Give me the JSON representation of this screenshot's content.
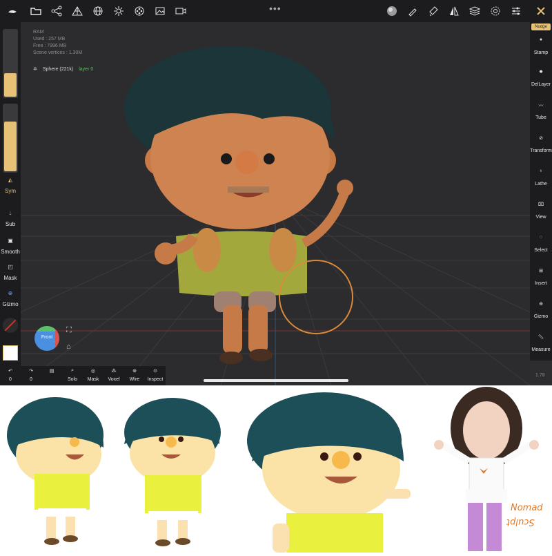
{
  "app": {
    "info": {
      "ram_label": "RAM",
      "used": "Used : 257 MB",
      "free": "Free : 7996 MB",
      "scene_vertices": "Scene vertices : 1.30M"
    },
    "scene": {
      "object": "Sphere (221k)",
      "layer": "layer 0"
    },
    "left_toolbar": {
      "sym": "Sym",
      "sub": "Sub",
      "smooth": "Smooth",
      "mask": "Mask",
      "gizmo": "Gizmo",
      "slider_radius_level": 0.35,
      "slider_intensity_level": 0.75
    },
    "right_toolbar": {
      "nudge": "Nudge",
      "items": [
        "Stamp",
        "DelLayer",
        "Tube",
        "Transform",
        "Lathe",
        "View",
        "Select",
        "Insert",
        "Gizmo",
        "Measure"
      ]
    },
    "bottom_toolbar": {
      "undo_count": "0",
      "redo_count": "0",
      "items": [
        "Solo",
        "Mask",
        "Voxel",
        "Wire",
        "Inspect"
      ]
    },
    "view_cube_label": "Front",
    "version": "1.78",
    "colors": {
      "accent": "#e7c175",
      "toolbar_bg": "#1c1c1e",
      "viewport_bg": "#2c2c2e",
      "brush_ring": "#d98a3a"
    }
  },
  "icons": {
    "top": [
      "app-logo-icon",
      "folder-icon",
      "share-graph-icon",
      "mesh-icon",
      "globe-icon",
      "sun-icon",
      "film-reel-icon",
      "image-icon",
      "camera-icon",
      "material-sphere-icon",
      "brush-icon",
      "paint-icon",
      "mirror-icon",
      "layers-icon",
      "settings-icon",
      "sliders-icon",
      "tools-icon"
    ]
  },
  "signature": {
    "line1": "Nomad",
    "line2": "Sculpt"
  }
}
